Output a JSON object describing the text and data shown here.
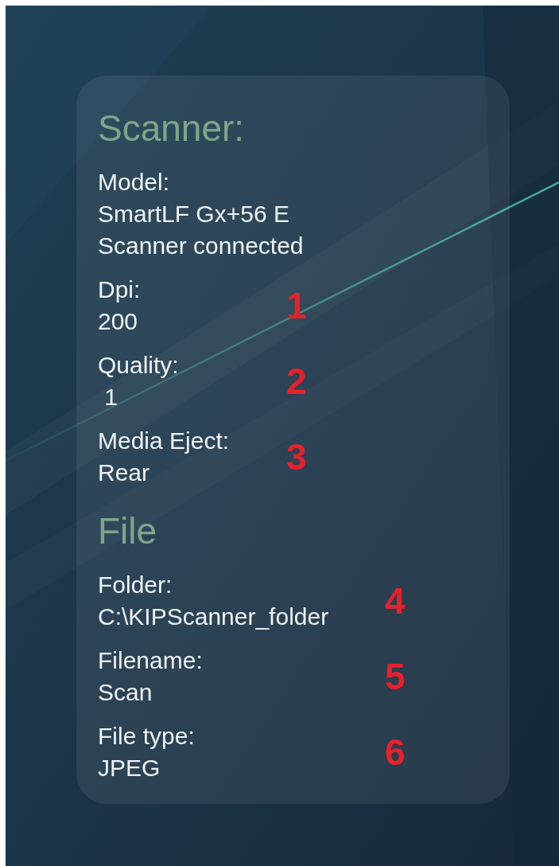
{
  "sections": [
    {
      "title": "Scanner:",
      "fields": [
        {
          "label": "Model:",
          "values": [
            "SmartLF Gx+56 E",
            "Scanner connected"
          ]
        },
        {
          "label": "Dpi:",
          "values": [
            "200"
          ],
          "annotation": "1"
        },
        {
          "label": "Quality:",
          "values": [
            " 1"
          ],
          "annotation": "2"
        },
        {
          "label": "Media Eject:",
          "values": [
            "Rear"
          ],
          "annotation": "3"
        }
      ]
    },
    {
      "title": "File",
      "fields": [
        {
          "label": "Folder:",
          "values": [
            "C:\\KIPScanner_folder"
          ],
          "annotation": "4"
        },
        {
          "label": "Filename:",
          "values": [
            "Scan"
          ],
          "annotation": "5"
        },
        {
          "label": "File type:",
          "values": [
            "JPEG"
          ],
          "annotation": "6"
        }
      ]
    }
  ]
}
